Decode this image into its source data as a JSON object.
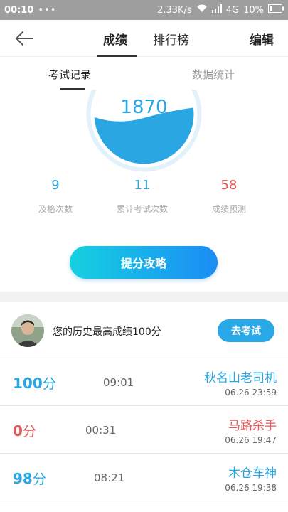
{
  "status_bar": {
    "time": "00:10",
    "dots": "•••",
    "speed": "2.33K/s",
    "network": "4G",
    "battery": "10%"
  },
  "header": {
    "tabs": [
      "成绩",
      "排行榜"
    ],
    "active_tab": "成绩",
    "edit_label": "编辑"
  },
  "subtabs": [
    "考试记录",
    "数据统计"
  ],
  "gauge": {
    "value": "1870",
    "fill_color": "#2aa6e3"
  },
  "stats": [
    {
      "value": "9",
      "label": "及格次数"
    },
    {
      "value": "11",
      "label": "累计考试次数"
    },
    {
      "value": "58",
      "label": "成绩预测"
    }
  ],
  "cta_label": "提分攻略",
  "best": {
    "text": "您的历史最高成绩100分",
    "button": "去考试"
  },
  "records": [
    {
      "score": "100",
      "unit": "分",
      "duration": "09:01",
      "title": "秋名山老司机",
      "date": "06.26  23:59",
      "color": "blue"
    },
    {
      "score": "0",
      "unit": "分",
      "duration": "00:31",
      "title": "马路杀手",
      "date": "06.26  19:47",
      "color": "red"
    },
    {
      "score": "98",
      "unit": "分",
      "duration": "08:21",
      "title": "木仓车神",
      "date": "06.26  19:38",
      "color": "blue"
    }
  ],
  "colors": {
    "accent_blue": "#2aa6e3",
    "accent_red": "#e05a5a",
    "cta_gradient_start": "#15d1e0",
    "cta_gradient_end": "#1b8cf5"
  }
}
